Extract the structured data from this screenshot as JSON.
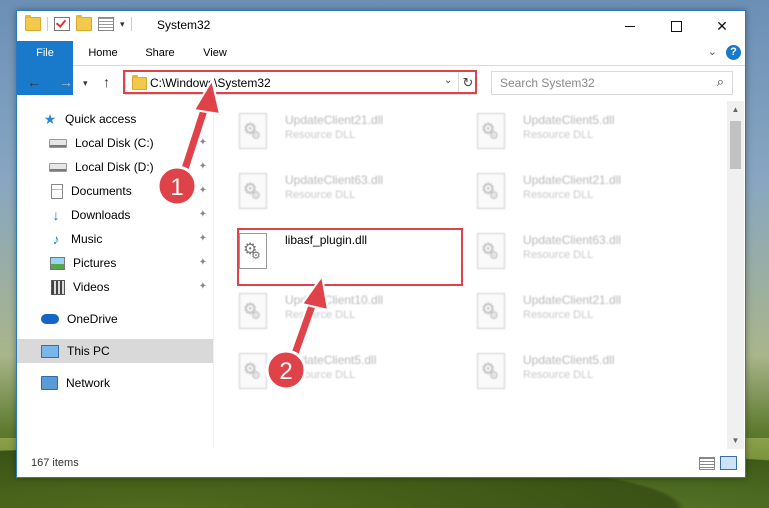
{
  "window": {
    "title": "System32",
    "controls": {
      "minimize": "—",
      "maximize": "☐",
      "close": "✕"
    }
  },
  "ribbon": {
    "tabs": [
      "File",
      "Home",
      "Share",
      "View"
    ],
    "expand_glyph": "⌄",
    "help_glyph": "?"
  },
  "nav": {
    "back_glyph": "←",
    "forward_glyph": "→",
    "recent_glyph": "▾",
    "up_glyph": "↑"
  },
  "address": {
    "path": "C:\\Windows\\System32",
    "dropdown_glyph": "⌄",
    "refresh_glyph": "↻"
  },
  "search": {
    "placeholder": "Search System32",
    "icon": "⌕"
  },
  "sidebar": {
    "items": [
      {
        "label": "Quick access",
        "icon": "star-icon",
        "glyph": "★"
      },
      {
        "label": "Local Disk (C:)",
        "icon": "drive-icon",
        "pin": "✦"
      },
      {
        "label": "Local Disk (D:)",
        "icon": "drive-icon",
        "pin": "✦"
      },
      {
        "label": "Documents",
        "icon": "document-icon",
        "pin": "✦"
      },
      {
        "label": "Downloads",
        "icon": "download-icon",
        "glyph": "↓",
        "pin": "✦"
      },
      {
        "label": "Music",
        "icon": "music-icon",
        "glyph": "♪",
        "pin": "✦"
      },
      {
        "label": "Pictures",
        "icon": "pictures-icon",
        "pin": "✦"
      },
      {
        "label": "Videos",
        "icon": "videos-icon",
        "pin": "✦"
      },
      {
        "label": "OneDrive",
        "icon": "cloud-icon"
      },
      {
        "label": "This PC",
        "icon": "computer-icon"
      },
      {
        "label": "Network",
        "icon": "network-icon"
      }
    ]
  },
  "files": [
    {
      "name": "UpdateClient21.dll",
      "type": "Resource DLL"
    },
    {
      "name": "UpdateClient5.dll",
      "type": "Resource DLL"
    },
    {
      "name": "UpdateClient63.dll",
      "type": "Resource DLL"
    },
    {
      "name": "UpdateClient21.dll",
      "type": "Resource DLL"
    },
    {
      "name": "libasf_plugin.dll",
      "type": ""
    },
    {
      "name": "UpdateClient63.dll",
      "type": "Resource DLL"
    },
    {
      "name": "UpdateClient10.dll",
      "type": "Resource DLL"
    },
    {
      "name": "UpdateClient21.dll",
      "type": "Resource DLL"
    },
    {
      "name": "UpdateClient5.dll",
      "type": "Resource DLL"
    },
    {
      "name": "UpdateClient5.dll",
      "type": "Resource DLL"
    }
  ],
  "status": {
    "item_count": "167 items"
  },
  "annotations": {
    "step1": "1",
    "step2": "2"
  },
  "colors": {
    "accent": "#1979ca",
    "highlight_box": "#e0424a"
  }
}
